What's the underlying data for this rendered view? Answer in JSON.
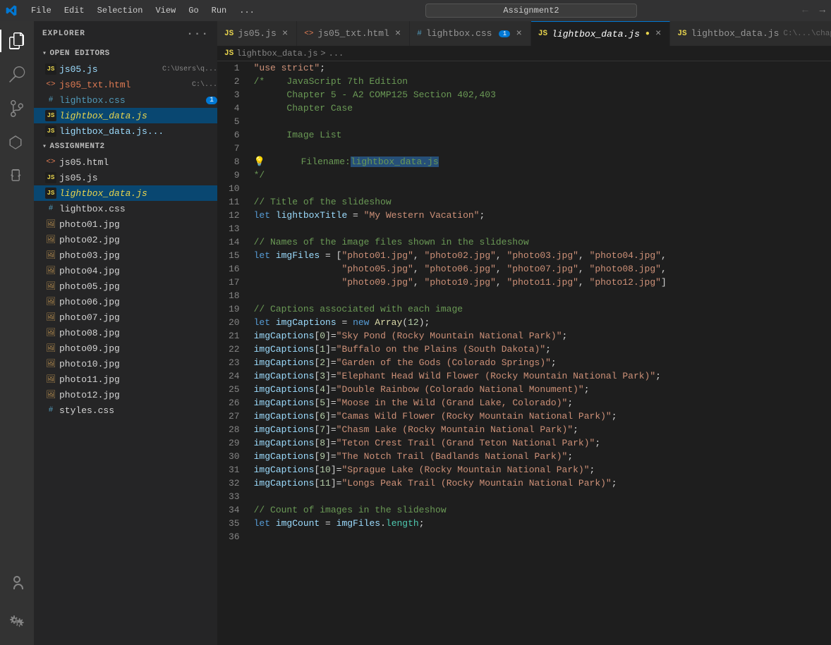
{
  "titlebar": {
    "logo": "VS",
    "menu": [
      "File",
      "Edit",
      "Selection",
      "View",
      "Go",
      "Run",
      "..."
    ],
    "search_placeholder": "Assignment2",
    "nav_back": "←",
    "nav_forward": "→"
  },
  "sidebar": {
    "header": "EXPLORER",
    "header_dots": "···",
    "open_editors_label": "OPEN EDITORS",
    "open_editors": [
      {
        "id": "js05",
        "icon": "JS",
        "label": "js05.js",
        "path": "C:\\Users\\q...",
        "type": "js"
      },
      {
        "id": "js05_txt",
        "icon": "<>",
        "label": "js05_txt.html",
        "path": "C:\\...",
        "type": "html"
      },
      {
        "id": "lightbox_css",
        "icon": "#",
        "label": "lightbox.css",
        "badge": "1",
        "type": "css"
      },
      {
        "id": "lightbox_data_active",
        "icon": "JS",
        "label": "lightbox_data.js",
        "type": "js",
        "active": true
      },
      {
        "id": "lightbox_data2",
        "icon": "JS",
        "label": "lightbox_data.js...",
        "type": "js"
      }
    ],
    "assignment2_label": "ASSIGNMENT2",
    "assignment2_files": [
      {
        "id": "js05_html",
        "icon": "<>",
        "label": "js05.html",
        "type": "html"
      },
      {
        "id": "js05_js",
        "icon": "JS",
        "label": "js05.js",
        "type": "js"
      },
      {
        "id": "lightbox_data_main",
        "icon": "JS",
        "label": "lightbox_data.js",
        "type": "js",
        "active": true
      },
      {
        "id": "lightbox_css_main",
        "icon": "#",
        "label": "lightbox.css",
        "type": "css"
      },
      {
        "id": "photo01",
        "icon": "img",
        "label": "photo01.jpg",
        "type": "img"
      },
      {
        "id": "photo02",
        "icon": "img",
        "label": "photo02.jpg",
        "type": "img"
      },
      {
        "id": "photo03",
        "icon": "img",
        "label": "photo03.jpg",
        "type": "img"
      },
      {
        "id": "photo04",
        "icon": "img",
        "label": "photo04.jpg",
        "type": "img"
      },
      {
        "id": "photo05",
        "icon": "img",
        "label": "photo05.jpg",
        "type": "img"
      },
      {
        "id": "photo06",
        "icon": "img",
        "label": "photo06.jpg",
        "type": "img"
      },
      {
        "id": "photo07",
        "icon": "img",
        "label": "photo07.jpg",
        "type": "img"
      },
      {
        "id": "photo08",
        "icon": "img",
        "label": "photo08.jpg",
        "type": "img"
      },
      {
        "id": "photo09",
        "icon": "img",
        "label": "photo09.jpg",
        "type": "img"
      },
      {
        "id": "photo10",
        "icon": "img",
        "label": "photo10.jpg",
        "type": "img"
      },
      {
        "id": "photo11",
        "icon": "img",
        "label": "photo11.jpg",
        "type": "img"
      },
      {
        "id": "photo12",
        "icon": "img",
        "label": "photo12.jpg",
        "type": "img"
      },
      {
        "id": "styles_css",
        "icon": "#",
        "label": "styles.css",
        "type": "css"
      }
    ]
  },
  "tabs": [
    {
      "id": "tab_js05",
      "icon": "JS",
      "label": "js05.js",
      "active": false
    },
    {
      "id": "tab_js05_txt",
      "icon": "<>",
      "label": "js05_txt.html",
      "active": false
    },
    {
      "id": "tab_lightbox_css",
      "icon": "#",
      "label": "lightbox.css",
      "badge": "1",
      "active": false
    },
    {
      "id": "tab_lightbox_data",
      "icon": "JS",
      "label": "lightbox_data.js",
      "active": true,
      "modified": true
    },
    {
      "id": "tab_lightbox_data2",
      "icon": "JS",
      "label": "lightbox_data.js",
      "path": "C:\\...\\chapter",
      "active": false
    }
  ],
  "breadcrumb": {
    "filename": "lightbox_data.js",
    "separator": ">",
    "ellipsis": "..."
  },
  "code": {
    "lines": [
      {
        "num": 1,
        "content": "\"use strict\";"
      },
      {
        "num": 2,
        "content": "/*    JavaScript 7th Edition"
      },
      {
        "num": 3,
        "content": "      Chapter 5 - A2 COMP125 Section 402,403"
      },
      {
        "num": 4,
        "content": "      Chapter Case"
      },
      {
        "num": 5,
        "content": ""
      },
      {
        "num": 6,
        "content": "      Image List"
      },
      {
        "num": 7,
        "content": ""
      },
      {
        "num": 8,
        "content": "      Filename: lightbox_data.js",
        "lightbulb": true
      },
      {
        "num": 9,
        "content": "*/"
      },
      {
        "num": 10,
        "content": ""
      },
      {
        "num": 11,
        "content": "// Title of the slideshow"
      },
      {
        "num": 12,
        "content": "let lightboxTitle = \"My Western Vacation\";"
      },
      {
        "num": 13,
        "content": ""
      },
      {
        "num": 14,
        "content": "// Names of the image files shown in the slideshow"
      },
      {
        "num": 15,
        "content": "let imgFiles = [\"photo01.jpg\", \"photo02.jpg\", \"photo03.jpg\", \"photo04.jpg\","
      },
      {
        "num": 16,
        "content": "                \"photo05.jpg\", \"photo06.jpg\", \"photo07.jpg\", \"photo08.jpg\","
      },
      {
        "num": 17,
        "content": "                \"photo09.jpg\", \"photo10.jpg\", \"photo11.jpg\", \"photo12.jpg\"]"
      },
      {
        "num": 18,
        "content": ""
      },
      {
        "num": 19,
        "content": "// Captions associated with each image"
      },
      {
        "num": 20,
        "content": "let imgCaptions = new Array(12);"
      },
      {
        "num": 21,
        "content": "imgCaptions[0]=\"Sky Pond (Rocky Mountain National Park)\";"
      },
      {
        "num": 22,
        "content": "imgCaptions[1]=\"Buffalo on the Plains (South Dakota)\";"
      },
      {
        "num": 23,
        "content": "imgCaptions[2]=\"Garden of the Gods (Colorado Springs)\";"
      },
      {
        "num": 24,
        "content": "imgCaptions[3]=\"Elephant Head Wild Flower (Rocky Mountain National Park)\";"
      },
      {
        "num": 25,
        "content": "imgCaptions[4]=\"Double Rainbow (Colorado National Monument)\";"
      },
      {
        "num": 26,
        "content": "imgCaptions[5]=\"Moose in the Wild (Grand Lake, Colorado)\";"
      },
      {
        "num": 27,
        "content": "imgCaptions[6]=\"Camas Wild Flower (Rocky Mountain National Park)\";"
      },
      {
        "num": 28,
        "content": "imgCaptions[7]=\"Chasm Lake (Rocky Mountain National Park)\";"
      },
      {
        "num": 29,
        "content": "imgCaptions[8]=\"Teton Crest Trail (Grand Teton National Park)\";"
      },
      {
        "num": 30,
        "content": "imgCaptions[9]=\"The Notch Trail (Badlands National Park)\";"
      },
      {
        "num": 31,
        "content": "imgCaptions[10]=\"Sprague Lake (Rocky Mountain National Park)\";"
      },
      {
        "num": 32,
        "content": "imgCaptions[11]=\"Longs Peak Trail (Rocky Mountain National Park)\";"
      },
      {
        "num": 33,
        "content": ""
      },
      {
        "num": 34,
        "content": "// Count of images in the slideshow"
      },
      {
        "num": 35,
        "content": "let imgCount = imgFiles.length;"
      },
      {
        "num": 36,
        "content": ""
      }
    ]
  }
}
